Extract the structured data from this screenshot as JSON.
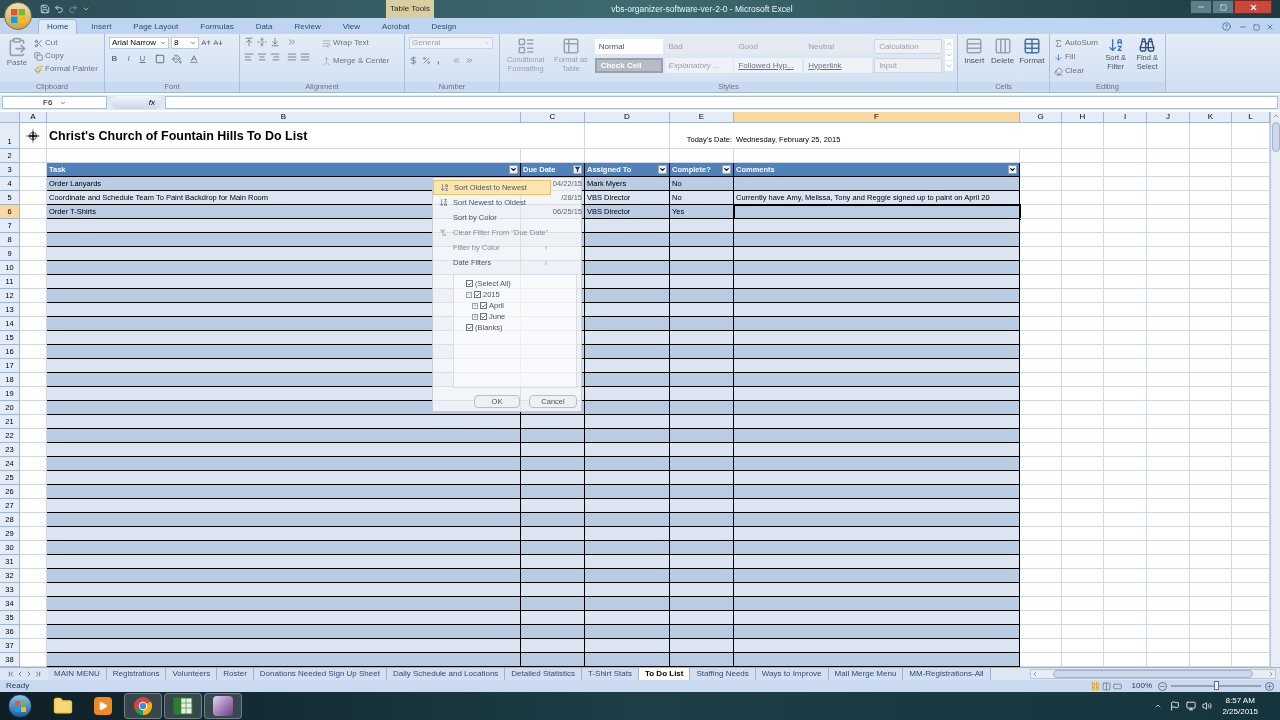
{
  "title_bar": {
    "title": "vbs-organizer-software-ver-2-0 - Microsoft Excel",
    "contextual_tab": "Table Tools"
  },
  "ribbon_tabs": [
    {
      "label": "Home",
      "selected": true
    },
    {
      "label": "Insert",
      "selected": false
    },
    {
      "label": "Page Layout",
      "selected": false
    },
    {
      "label": "Formulas",
      "selected": false
    },
    {
      "label": "Data",
      "selected": false
    },
    {
      "label": "Review",
      "selected": false
    },
    {
      "label": "View",
      "selected": false
    },
    {
      "label": "Acrobat",
      "selected": false
    },
    {
      "label": "Design",
      "selected": false
    }
  ],
  "ribbon": {
    "clipboard": {
      "label": "Clipboard",
      "paste": "Paste",
      "cut": "Cut",
      "copy": "Copy",
      "format_painter": "Format Painter"
    },
    "font": {
      "label": "Font",
      "font_name": "Arial Narrow",
      "font_size": "8",
      "bold": "B",
      "italic": "I",
      "underline": "U"
    },
    "alignment": {
      "label": "Alignment",
      "wrap_text": "Wrap Text",
      "merge_center": "Merge & Center"
    },
    "number": {
      "label": "Number",
      "format": "General",
      "comma": ","
    },
    "styles": {
      "label": "Styles",
      "conditional_formatting": "Conditional Formatting",
      "format_as_table": "Format as Table",
      "cells": [
        {
          "label": "Normal",
          "kind": "normal"
        },
        {
          "label": "Bad",
          "kind": "bad"
        },
        {
          "label": "Good",
          "kind": "good"
        },
        {
          "label": "Neutral",
          "kind": "neutral"
        },
        {
          "label": "Calculation",
          "kind": "calculation"
        },
        {
          "label": "Check Cell",
          "kind": "check"
        },
        {
          "label": "Explanatory ...",
          "kind": "explanatory"
        },
        {
          "label": "Followed Hyp...",
          "kind": "link"
        },
        {
          "label": "Hyperlink",
          "kind": "link"
        },
        {
          "label": "Input",
          "kind": "input"
        }
      ]
    },
    "cells": {
      "label": "Cells",
      "insert": "Insert",
      "delete": "Delete",
      "format": "Format"
    },
    "editing": {
      "label": "Editing",
      "autosum": "AutoSum",
      "fill": "Fill",
      "clear": "Clear",
      "sort_filter": "Sort & Filter",
      "find_select": "Find & Select"
    }
  },
  "formula_bar": {
    "name_box": "F6",
    "function_label": "fx"
  },
  "sheet": {
    "column_headers": [
      {
        "label": "A",
        "selected": false
      },
      {
        "label": "B",
        "selected": false
      },
      {
        "label": "C",
        "selected": false
      },
      {
        "label": "D",
        "selected": false
      },
      {
        "label": "E",
        "selected": false
      },
      {
        "label": "F",
        "selected": true
      },
      {
        "label": "G",
        "selected": false
      },
      {
        "label": "H",
        "selected": false
      },
      {
        "label": "I",
        "selected": false
      },
      {
        "label": "J",
        "selected": false
      },
      {
        "label": "K",
        "selected": false
      },
      {
        "label": "L",
        "selected": false
      }
    ],
    "row_headers": [
      {
        "label": "1",
        "selected": false
      },
      {
        "label": "2",
        "selected": false
      },
      {
        "label": "3",
        "selected": false
      },
      {
        "label": "4",
        "selected": false
      },
      {
        "label": "5",
        "selected": false
      },
      {
        "label": "6",
        "selected": true
      },
      {
        "label": "7",
        "selected": false
      },
      {
        "label": "8",
        "selected": false
      },
      {
        "label": "9",
        "selected": false
      },
      {
        "label": "10",
        "selected": false
      },
      {
        "label": "11",
        "selected": false
      },
      {
        "label": "12",
        "selected": false
      },
      {
        "label": "13",
        "selected": false
      },
      {
        "label": "14",
        "selected": false
      },
      {
        "label": "15",
        "selected": false
      },
      {
        "label": "16",
        "selected": false
      },
      {
        "label": "17",
        "selected": false
      },
      {
        "label": "18",
        "selected": false
      },
      {
        "label": "19",
        "selected": false
      },
      {
        "label": "20",
        "selected": false
      },
      {
        "label": "21",
        "selected": false
      },
      {
        "label": "22",
        "selected": false
      },
      {
        "label": "23",
        "selected": false
      },
      {
        "label": "24",
        "selected": false
      },
      {
        "label": "25",
        "selected": false
      },
      {
        "label": "26",
        "selected": false
      },
      {
        "label": "27",
        "selected": false
      },
      {
        "label": "28",
        "selected": false
      },
      {
        "label": "29",
        "selected": false
      },
      {
        "label": "30",
        "selected": false
      },
      {
        "label": "31",
        "selected": false
      },
      {
        "label": "32",
        "selected": false
      },
      {
        "label": "33",
        "selected": false
      },
      {
        "label": "34",
        "selected": false
      },
      {
        "label": "35",
        "selected": false
      },
      {
        "label": "36",
        "selected": false
      },
      {
        "label": "37",
        "selected": false
      },
      {
        "label": "38",
        "selected": false
      }
    ],
    "title": "Christ's Church of Fountain Hills To Do List",
    "date_label": "Today's Date:",
    "date_value": "Wednesday, February 25, 2015",
    "table": {
      "columns": [
        {
          "label": "Task",
          "filtered": false
        },
        {
          "label": "Due Date",
          "filtered": true
        },
        {
          "label": "Assigned To",
          "filtered": false
        },
        {
          "label": "Complete?",
          "filtered": false
        },
        {
          "label": "Comments",
          "filtered": false
        }
      ],
      "rows": [
        {
          "task": "Order Lanyards",
          "due_date": "04/22/15",
          "assigned_to": "Mark Myers",
          "complete": "No"
        },
        {
          "task": "Coordinate and Schedule Team To Paint Backdrop for Main Room",
          "due_date": "/28/15",
          "assigned_to": "VBS Director",
          "complete": "No",
          "comments": "Currently have Amy, Melissa, Tony and Reggie signed up to paint on April 20"
        },
        {
          "task": "Order T-Shirts",
          "due_date": "06/25/15",
          "assigned_to": "VBS Director",
          "complete": "Yes"
        }
      ]
    }
  },
  "filter_menu": {
    "items": [
      {
        "label": "Sort Oldest to Newest",
        "kind": "sort-asc",
        "highlighted": true,
        "disabled": false,
        "submenu": false
      },
      {
        "label": "Sort Newest to Oldest",
        "kind": "sort-desc",
        "highlighted": false,
        "disabled": false,
        "submenu": false
      },
      {
        "label": "Sort by Color",
        "kind": "plain",
        "highlighted": false,
        "disabled": false,
        "submenu": false
      },
      {
        "label": "Clear Filter From \"Due Date\"",
        "kind": "clear",
        "highlighted": false,
        "disabled": true,
        "submenu": false
      },
      {
        "label": "Filter by Color",
        "kind": "plain",
        "highlighted": false,
        "disabled": true,
        "submenu": true
      },
      {
        "label": "Date Filters",
        "kind": "plain",
        "highlighted": false,
        "disabled": false,
        "submenu": true
      }
    ],
    "tree": [
      {
        "label": "(Select All)",
        "checked": true
      },
      {
        "label": "2015",
        "checked": true,
        "expanded": true,
        "children": [
          {
            "label": "April",
            "checked": true,
            "expanded": false
          },
          {
            "label": "June",
            "checked": true,
            "expanded": false
          }
        ]
      },
      {
        "label": "(Blanks)",
        "checked": true
      }
    ],
    "ok": "OK",
    "cancel": "Cancel"
  },
  "sheet_tabs": [
    {
      "label": "MAIN MENU",
      "selected": false
    },
    {
      "label": "Registrations",
      "selected": false
    },
    {
      "label": "Volunteers",
      "selected": false
    },
    {
      "label": "Roster",
      "selected": false
    },
    {
      "label": "Donations Needed Sign Up Sheet",
      "selected": false
    },
    {
      "label": "Daily Schedule and Locations",
      "selected": false
    },
    {
      "label": "Detailed Statistics",
      "selected": false
    },
    {
      "label": "T-Shirt Stats",
      "selected": false
    },
    {
      "label": "To Do List",
      "selected": true
    },
    {
      "label": "Staffing Needs",
      "selected": false
    },
    {
      "label": "Ways to Improve",
      "selected": false
    },
    {
      "label": "Mail Merge Menu",
      "selected": false
    },
    {
      "label": "MM-Registrations-All",
      "selected": false
    }
  ],
  "status_bar": {
    "status": "Ready",
    "zoom": "100%",
    "zoom_slider": {
      "level": 0.5
    }
  },
  "taskbar": {
    "apps": [
      {
        "kind": "folder",
        "running": false
      },
      {
        "kind": "media",
        "running": false
      },
      {
        "kind": "browser",
        "running": true
      },
      {
        "kind": "spreadsheet",
        "running": true
      },
      {
        "kind": "graphics",
        "running": true
      }
    ],
    "time": "8:57 AM",
    "date": "2/25/2015"
  }
}
